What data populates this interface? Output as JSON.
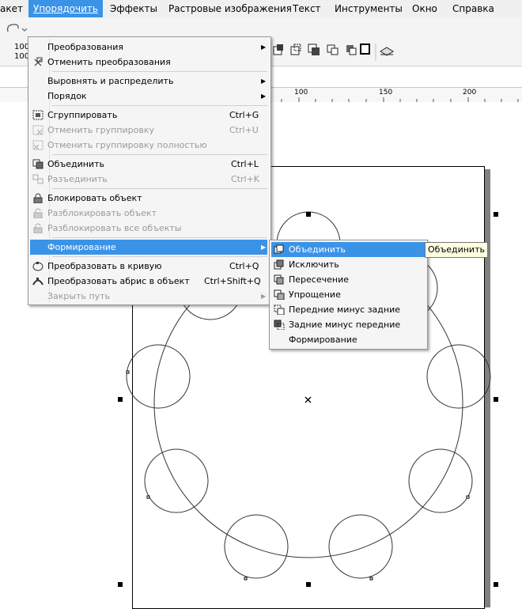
{
  "menubar": [
    {
      "label": "акет"
    },
    {
      "label": "Упорядочить"
    },
    {
      "label": "Эффекты"
    },
    {
      "label": "Растровые изображения"
    },
    {
      "label": "Текст"
    },
    {
      "label": "Инструменты"
    },
    {
      "label": "Окно"
    },
    {
      "label": "Справка"
    }
  ],
  "size_fields": {
    "width": "100",
    "height": "100"
  },
  "ruler": {
    "labels": [
      "100",
      "150",
      "200"
    ]
  },
  "arrange_menu": [
    {
      "label": "Преобразования",
      "shortcut": "",
      "submenu": true,
      "disabled": false,
      "icon": ""
    },
    {
      "label": "Отменить преобразования",
      "shortcut": "",
      "submenu": false,
      "disabled": false,
      "icon": "clear-transform-icon"
    },
    {
      "label": "Выровнять и распределить",
      "shortcut": "",
      "submenu": true,
      "disabled": false,
      "icon": ""
    },
    {
      "label": "Порядок",
      "shortcut": "",
      "submenu": true,
      "disabled": false,
      "icon": ""
    },
    {
      "label": "Сгруппировать",
      "shortcut": "Ctrl+G",
      "submenu": false,
      "disabled": false,
      "icon": "group-icon"
    },
    {
      "label": "Отменить группировку",
      "shortcut": "Ctrl+U",
      "submenu": false,
      "disabled": true,
      "icon": "ungroup-icon"
    },
    {
      "label": "Отменить группировку полностью",
      "shortcut": "",
      "submenu": false,
      "disabled": true,
      "icon": "ungroup-all-icon"
    },
    {
      "label": "Объединить",
      "shortcut": "Ctrl+L",
      "submenu": false,
      "disabled": false,
      "icon": "combine-icon"
    },
    {
      "label": "Разъединить",
      "shortcut": "Ctrl+K",
      "submenu": false,
      "disabled": true,
      "icon": "break-apart-icon"
    },
    {
      "label": "Блокировать объект",
      "shortcut": "",
      "submenu": false,
      "disabled": false,
      "icon": "lock-icon"
    },
    {
      "label": "Разблокировать объект",
      "shortcut": "",
      "submenu": false,
      "disabled": true,
      "icon": "unlock-icon"
    },
    {
      "label": "Разблокировать все объекты",
      "shortcut": "",
      "submenu": false,
      "disabled": true,
      "icon": "unlock-all-icon"
    },
    {
      "label": "Формирование",
      "shortcut": "",
      "submenu": true,
      "disabled": false,
      "icon": ""
    },
    {
      "label": "Преобразовать в кривую",
      "shortcut": "Ctrl+Q",
      "submenu": false,
      "disabled": false,
      "icon": "convert-to-curves-icon"
    },
    {
      "label": "Преобразовать абрис в объект",
      "shortcut": "Ctrl+Shift+Q",
      "submenu": false,
      "disabled": false,
      "icon": "outline-to-object-icon"
    },
    {
      "label": "Закрыть путь",
      "shortcut": "",
      "submenu": true,
      "disabled": true,
      "icon": ""
    }
  ],
  "shaping_submenu": [
    {
      "label": "Объединить",
      "icon": "weld-icon"
    },
    {
      "label": "Исключить",
      "icon": "trim-icon"
    },
    {
      "label": "Пересечение",
      "icon": "intersect-icon"
    },
    {
      "label": "Упрощение",
      "icon": "simplify-icon"
    },
    {
      "label": "Передние минус задние",
      "icon": "front-minus-back-icon"
    },
    {
      "label": "Задние минус передние",
      "icon": "back-minus-front-icon"
    },
    {
      "label": "Формирование",
      "icon": ""
    }
  ],
  "tooltip": "Объединить",
  "colors": {
    "highlight": "#3b93e8",
    "menu_bg": "#f5f5f5",
    "page_shadow": "#808080"
  }
}
